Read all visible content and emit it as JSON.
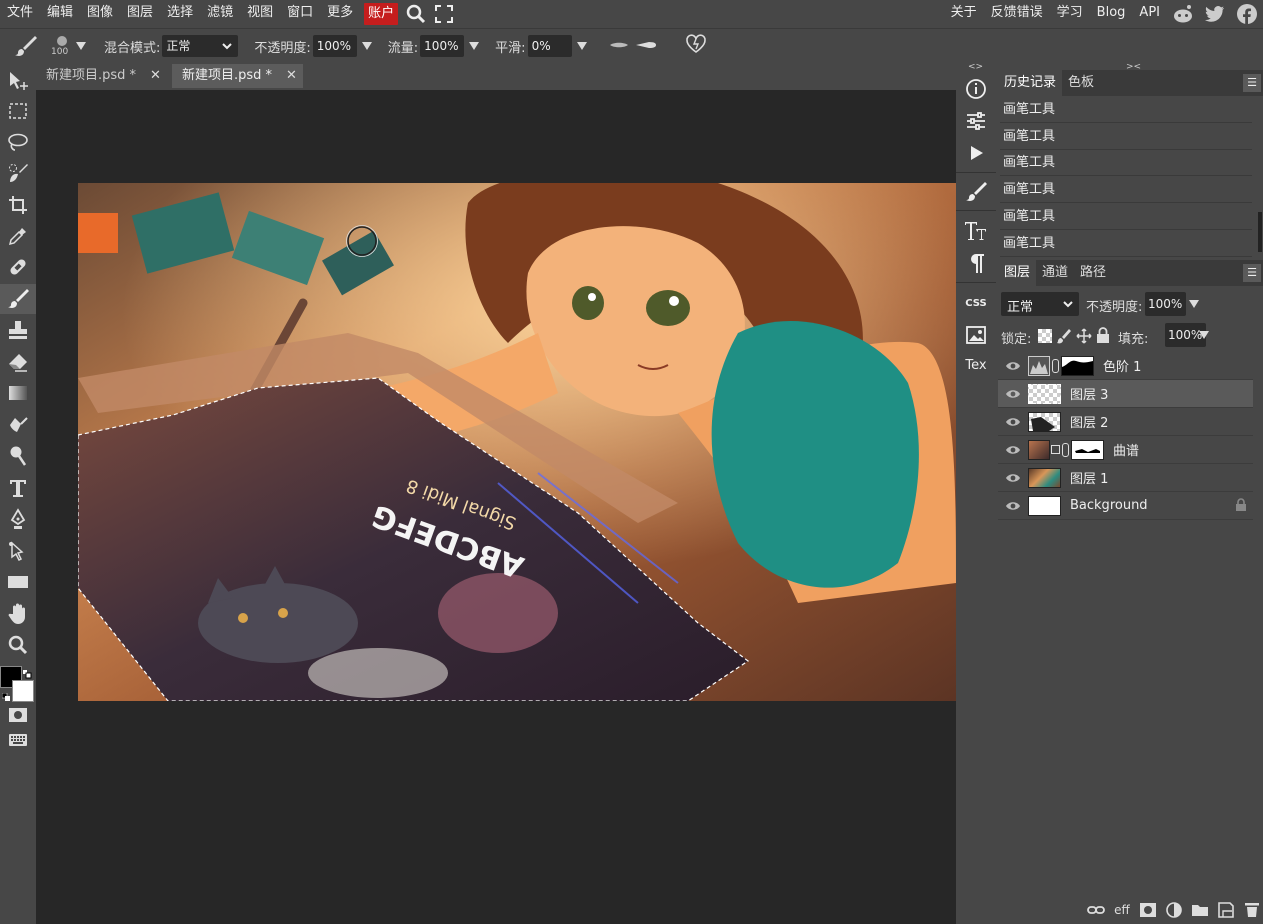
{
  "menubar": {
    "items": [
      "文件",
      "编辑",
      "图像",
      "图层",
      "选择",
      "滤镜",
      "视图",
      "窗口",
      "更多"
    ],
    "account": "账户",
    "right_links": [
      "关于",
      "反馈错误",
      "学习",
      "Blog",
      "API"
    ],
    "accent": "#c51d1d"
  },
  "options": {
    "brush_size": "100",
    "blend_label": "混合模式:",
    "blend_value": "正常",
    "opacity_label": "不透明度:",
    "opacity_value": "100%",
    "flow_label": "流量:",
    "flow_value": "100%",
    "smooth_label": "平滑:",
    "smooth_value": "0%"
  },
  "doc_tabs": [
    {
      "label": "新建项目.psd *",
      "close": "✕"
    },
    {
      "label": "新建项目.psd *",
      "close": "✕"
    }
  ],
  "side_icons": [
    "info-icon",
    "sliders-icon",
    "play-icon",
    "brush-icon",
    "type-tt-icon",
    "paragraph-icon",
    "css-icon",
    "image-icon",
    "text-icon"
  ],
  "side_labels": {
    "css": "CSS",
    "tex": "Tex"
  },
  "canvas_text": {
    "line1": "Signal Midi 8"
  },
  "history": {
    "tabs": [
      "历史记录",
      "色板"
    ],
    "items": [
      "画笔工具",
      "画笔工具",
      "画笔工具",
      "画笔工具",
      "画笔工具",
      "画笔工具"
    ]
  },
  "layers": {
    "tabs": [
      "图层",
      "通道",
      "路径"
    ],
    "blend_value": "正常",
    "opacity_label": "不透明度:",
    "opacity_value": "100%",
    "lock_label": "锁定:",
    "fill_label": "填充:",
    "fill_value": "100%",
    "rows": [
      {
        "name": "色阶 1"
      },
      {
        "name": "图层 3"
      },
      {
        "name": "图层 2"
      },
      {
        "name": "曲谱"
      },
      {
        "name": "图层 1"
      },
      {
        "name": "Background"
      }
    ],
    "bottom_labels": {
      "eff": "eff"
    }
  }
}
